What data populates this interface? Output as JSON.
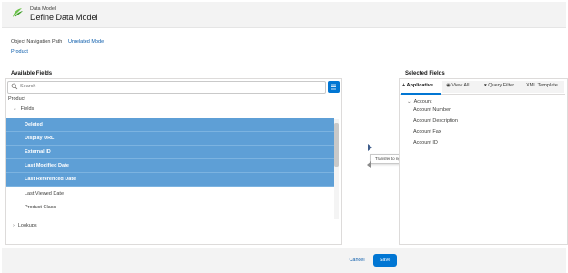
{
  "header": {
    "subtitle": "Data Model",
    "title": "Define Data Model"
  },
  "nav": {
    "label": "Object Navigation Path",
    "link": "Unrelated Mode",
    "product": "Product"
  },
  "available": {
    "title": "Available Fields",
    "search_placeholder": "Search",
    "root": "Product",
    "group": "Fields",
    "selected_rows": [
      "Deleted",
      "Display URL",
      "External ID",
      "Last Modified Date",
      "Last Referenced Date"
    ],
    "rows": [
      "Last Viewed Date",
      "Product Class"
    ],
    "lookups": "Lookups"
  },
  "transfer": {
    "tooltip": "Transfer to right side"
  },
  "selected": {
    "title": "Selected Fields",
    "tabs": {
      "applicative": "+ Applicative",
      "view_all": "View All",
      "query_filter": "Query Filter",
      "xml_template": "XML Template"
    },
    "group": "Account",
    "items": [
      "Account Number",
      "Account Description",
      "Account Fax",
      "Account ID"
    ]
  },
  "footer": {
    "cancel": "Cancel",
    "save": "Save"
  },
  "colors": {
    "brand": "#0176d3",
    "selected_row": "#5e9fd6",
    "link": "#0b5cab"
  }
}
